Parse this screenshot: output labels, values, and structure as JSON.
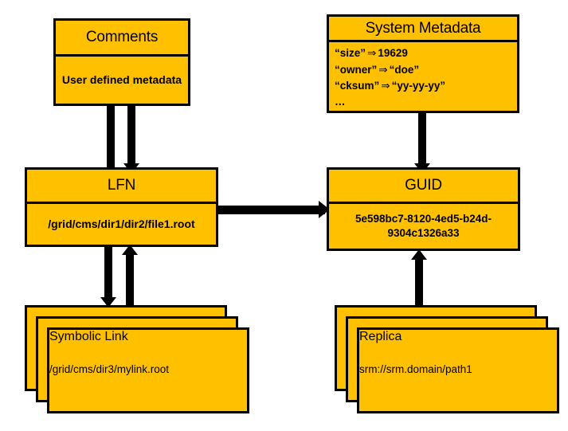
{
  "diagram": {
    "title": "Grid file catalogue entity diagram",
    "colors": {
      "node_fill": "#FFC000",
      "node_border": "#000000",
      "background": "#FFFFFF",
      "connector": "#000000"
    },
    "nodes": {
      "comments": {
        "title": "Comments",
        "body": "User defined metadata"
      },
      "system_metadata": {
        "title": "System Metadata",
        "rows": [
          {
            "key": "“size”",
            "arrow": "⇒",
            "value": "19629"
          },
          {
            "key": "“owner”",
            "arrow": "⇒",
            "value": "“doe”"
          },
          {
            "key": "“cksum”",
            "arrow": "⇒",
            "value": "“yy-yy-yy”"
          },
          {
            "key": "…",
            "arrow": "",
            "value": ""
          }
        ]
      },
      "lfn": {
        "title": "LFN",
        "body": "/grid/cms/dir1/dir2/file1.root"
      },
      "guid": {
        "title": "GUID",
        "body": "5e598bc7-8120-4ed5-b24d-9304c1326a33"
      },
      "symbolic_link": {
        "title": "Symbolic Link",
        "body": "/grid/cms/dir3/mylink.root",
        "stack_count": 3
      },
      "replica": {
        "title": "Replica",
        "body": "srm://srm.domain/path1",
        "stack_count": 3
      }
    },
    "connectors": [
      {
        "name": "comments-to-lfn-plain",
        "from": "comments",
        "to": "lfn",
        "direction": "none"
      },
      {
        "name": "comments-to-lfn-arrow",
        "from": "comments",
        "to": "lfn",
        "direction": "down"
      },
      {
        "name": "system-metadata-to-guid",
        "from": "system_metadata",
        "to": "guid",
        "direction": "down"
      },
      {
        "name": "lfn-to-guid",
        "from": "lfn",
        "to": "guid",
        "direction": "right"
      },
      {
        "name": "lfn-to-symbolic-link",
        "from": "lfn",
        "to": "symbolic_link",
        "direction": "down"
      },
      {
        "name": "symbolic-link-to-lfn",
        "from": "symbolic_link",
        "to": "lfn",
        "direction": "up"
      },
      {
        "name": "replica-to-guid",
        "from": "replica",
        "to": "guid",
        "direction": "up"
      }
    ]
  }
}
